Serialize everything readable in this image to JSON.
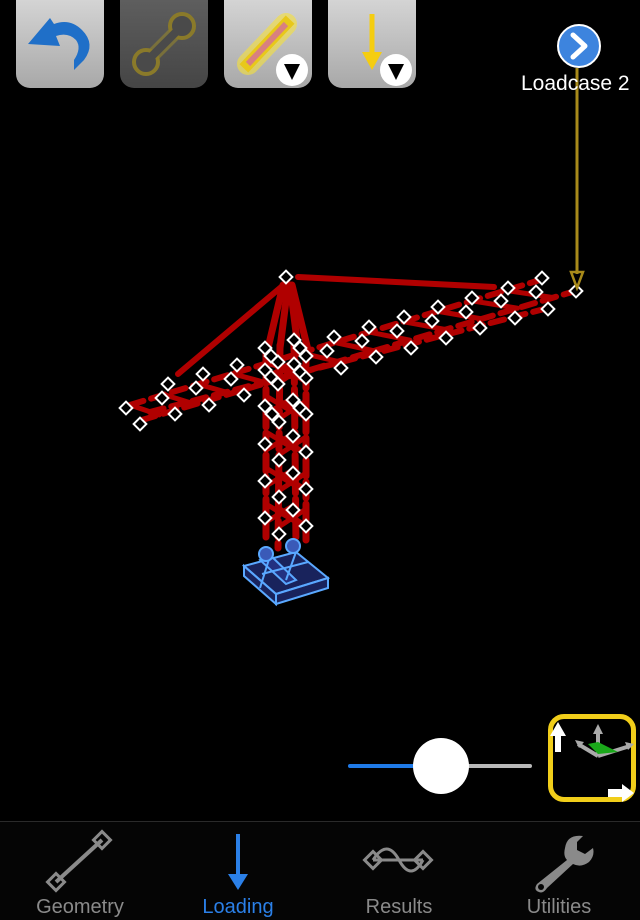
{
  "toolbar": {
    "buttons": [
      {
        "id": "undo",
        "icon": "undo-icon",
        "active": true
      },
      {
        "id": "member",
        "icon": "member-icon",
        "active": false
      },
      {
        "id": "member-load",
        "icon": "member-load-icon",
        "active": true,
        "has_dropdown": true
      },
      {
        "id": "point-load",
        "icon": "point-load-icon",
        "active": true,
        "has_dropdown": true
      }
    ]
  },
  "loadcase": {
    "label": "Loadcase 2",
    "next_icon": "chevron-right-icon"
  },
  "model": {
    "member_color": "#b00000",
    "node_color": "#ffffff",
    "support_color": "#5aa8ff",
    "load_color": "#a88a1a"
  },
  "slider": {
    "value": 0.5
  },
  "view_button": {
    "icon": "axes-view-icon",
    "border_color": "#f1ce1a"
  },
  "tabbar": {
    "tabs": [
      {
        "label": "Geometry",
        "icon": "member-icon",
        "active": false
      },
      {
        "label": "Loading",
        "icon": "arrow-down-icon",
        "active": true
      },
      {
        "label": "Results",
        "icon": "deflection-icon",
        "active": false
      },
      {
        "label": "Utilities",
        "icon": "wrench-icon",
        "active": false
      }
    ]
  },
  "colors": {
    "accent": "#2b80e8",
    "inactive": "#8a8a8a",
    "highlight": "#f1ce1a"
  }
}
